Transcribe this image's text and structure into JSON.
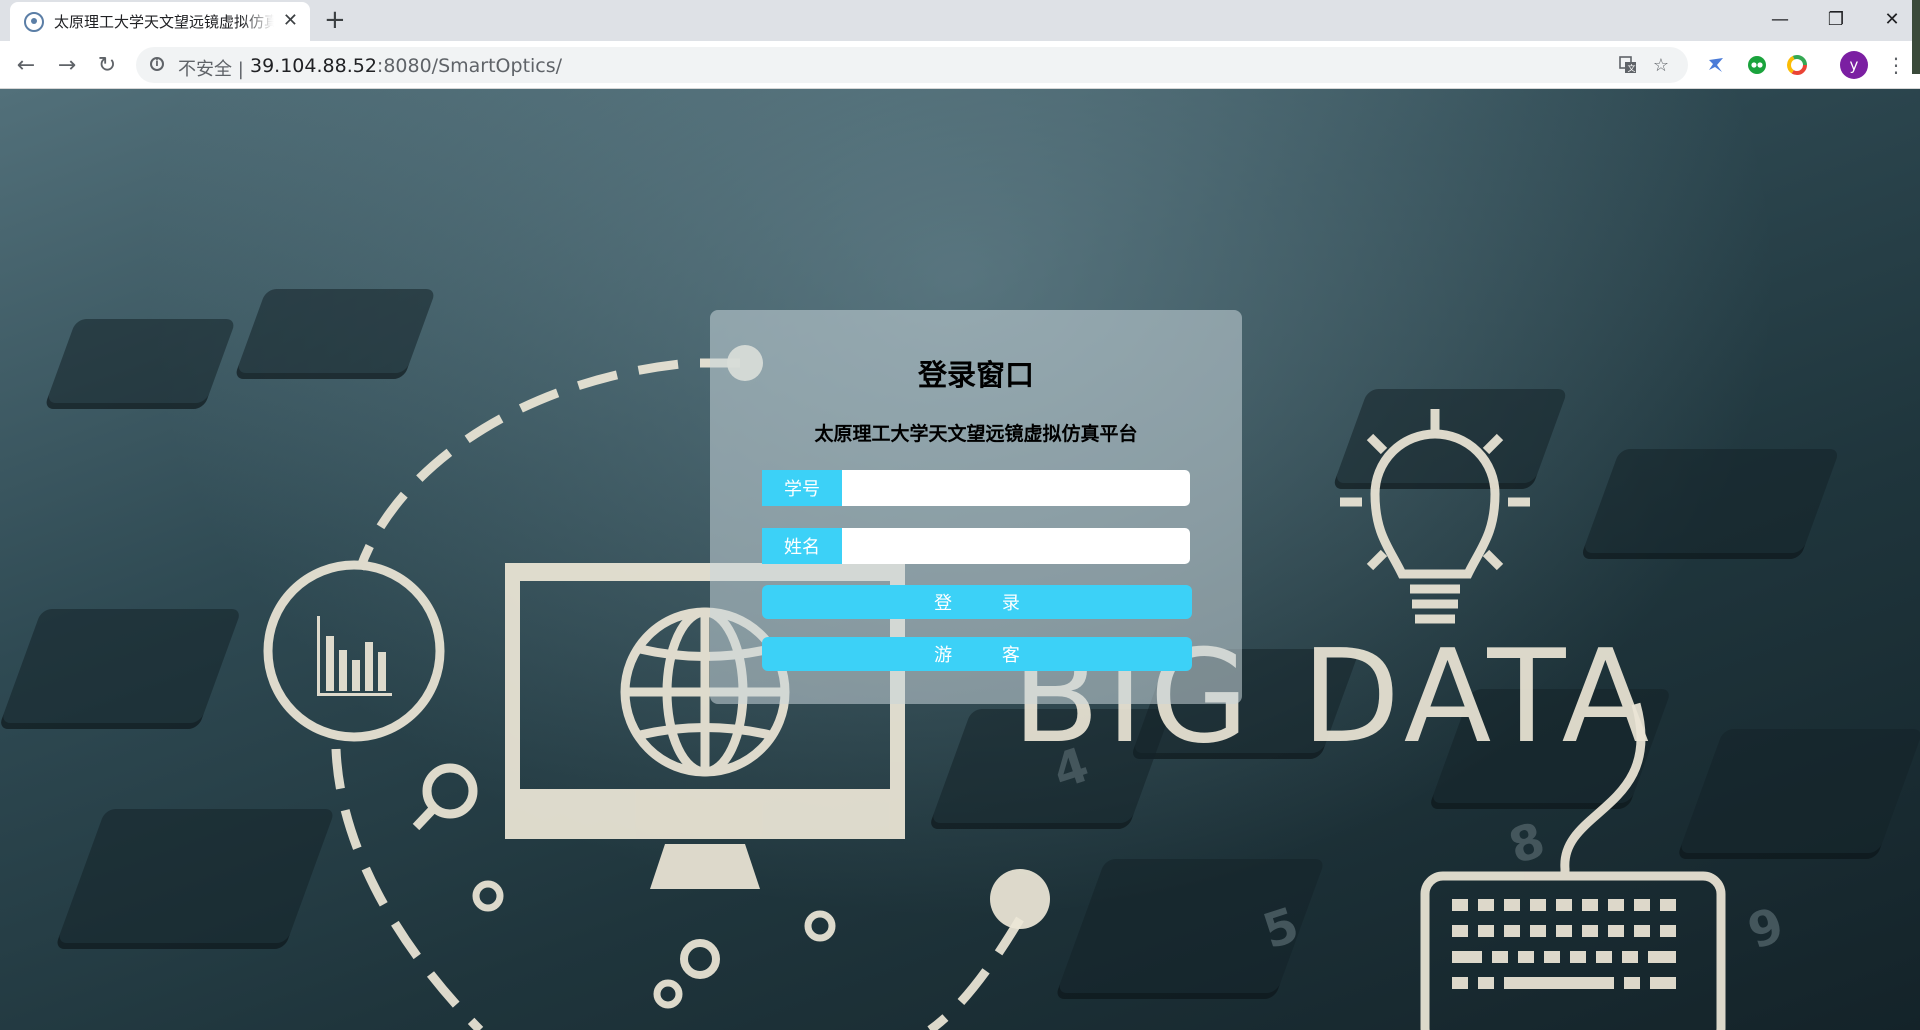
{
  "browser": {
    "tab_title": "太原理工大学天文望远镜虚拟仿真平台",
    "tab_close": "✕",
    "new_tab": "+",
    "window_controls": {
      "minimize": "—",
      "restore": "❐",
      "close": "✕"
    },
    "nav": {
      "back": "←",
      "forward": "→",
      "reload": "↻"
    },
    "security_label": "不安全 |",
    "url_host": "39.104.88.52",
    "url_path": ":8080/SmartOptics/",
    "avatar_letter": "y",
    "menu": "⋮",
    "icons": [
      "info-icon",
      "translate-icon",
      "star-icon",
      "extension-bird-icon",
      "extension-owl-icon",
      "extension-ring-icon",
      "avatar",
      "menu-dots-icon"
    ]
  },
  "background": {
    "big_data_text": "BIG DATA",
    "key_labels": [
      "8",
      "5",
      "9",
      "4"
    ]
  },
  "login": {
    "title": "登录窗口",
    "subtitle": "太原理工大学天文望远镜虚拟仿真平台",
    "student_id_label": "学号",
    "student_id_value": "",
    "name_label": "姓名",
    "name_value": "",
    "login_button": "登 录",
    "guest_button": "游 客"
  },
  "colors": {
    "accent": "#3cd1f7",
    "art": "#ece6d6",
    "background_dark": "#1f353c"
  }
}
